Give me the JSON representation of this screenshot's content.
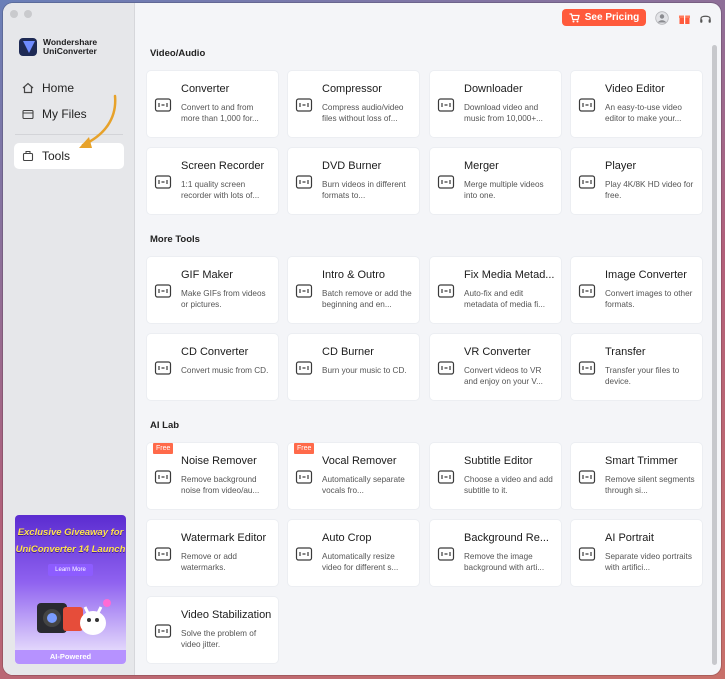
{
  "app": {
    "brand_line1": "Wondershare",
    "brand_line2": "UniConverter"
  },
  "sidebar": {
    "items": [
      {
        "label": "Home",
        "icon": "home-icon"
      },
      {
        "label": "My Files",
        "icon": "folder-icon"
      },
      {
        "label": "Tools",
        "icon": "toolbox-icon",
        "active": true
      }
    ],
    "promo": {
      "title_line1": "Exclusive Giveaway for",
      "title_line2": "UniConverter 14 Launch",
      "button": "Learn More",
      "footer": "AI-Powered"
    }
  },
  "topbar": {
    "pricing_label": "See Pricing",
    "icons": [
      "cart-icon",
      "user-icon",
      "gift-icon",
      "headset-icon"
    ]
  },
  "sections": [
    {
      "title": "Video/Audio",
      "cards": [
        {
          "title": "Converter",
          "desc": "Convert to and from more than 1,000 for...",
          "icon": "converter-icon"
        },
        {
          "title": "Compressor",
          "desc": "Compress audio/video files without loss of...",
          "icon": "compressor-icon"
        },
        {
          "title": "Downloader",
          "desc": "Download video and music from 10,000+...",
          "icon": "downloader-icon"
        },
        {
          "title": "Video Editor",
          "desc": "An easy-to-use video editor to make your...",
          "icon": "video-editor-icon"
        },
        {
          "title": "Screen Recorder",
          "desc": "1:1 quality screen recorder with lots of...",
          "icon": "screen-recorder-icon"
        },
        {
          "title": "DVD Burner",
          "desc": "Burn videos in different formats to...",
          "icon": "dvd-icon"
        },
        {
          "title": "Merger",
          "desc": "Merge multiple videos into one.",
          "icon": "merger-icon"
        },
        {
          "title": "Player",
          "desc": "Play 4K/8K HD video for free.",
          "icon": "player-icon"
        }
      ]
    },
    {
      "title": "More Tools",
      "cards": [
        {
          "title": "GIF Maker",
          "desc": "Make GIFs from videos or pictures.",
          "icon": "gif-icon"
        },
        {
          "title": "Intro & Outro",
          "desc": "Batch remove or add the beginning and en...",
          "icon": "intro-outro-icon"
        },
        {
          "title": "Fix Media Metad...",
          "desc": "Auto-fix and edit metadata of media fi...",
          "icon": "metadata-icon"
        },
        {
          "title": "Image Converter",
          "desc": "Convert images to other formats.",
          "icon": "image-icon"
        },
        {
          "title": "CD Converter",
          "desc": "Convert music from CD.",
          "icon": "cd-converter-icon"
        },
        {
          "title": "CD Burner",
          "desc": "Burn your music to CD.",
          "icon": "cd-burner-icon"
        },
        {
          "title": "VR Converter",
          "desc": "Convert videos to VR and enjoy on your V...",
          "icon": "vr-icon"
        },
        {
          "title": "Transfer",
          "desc": "Transfer your files to device.",
          "icon": "transfer-icon"
        }
      ]
    },
    {
      "title": "AI Lab",
      "cards": [
        {
          "title": "Noise Remover",
          "desc": "Remove background noise from video/au...",
          "icon": "noise-icon",
          "badge": "Free"
        },
        {
          "title": "Vocal Remover",
          "desc": "Automatically separate vocals fro...",
          "icon": "vocal-icon",
          "badge": "Free"
        },
        {
          "title": "Subtitle Editor",
          "desc": "Choose a video and add subtitle to it.",
          "icon": "subtitle-icon"
        },
        {
          "title": "Smart Trimmer",
          "desc": "Remove silent segments through si...",
          "icon": "trimmer-icon"
        },
        {
          "title": "Watermark Editor",
          "desc": "Remove or add watermarks.",
          "icon": "watermark-icon"
        },
        {
          "title": "Auto Crop",
          "desc": "Automatically resize video for different s...",
          "icon": "crop-icon"
        },
        {
          "title": "Background Re...",
          "desc": "Remove the image background with arti...",
          "icon": "background-icon"
        },
        {
          "title": "AI Portrait",
          "desc": "Separate video portraits with artifici...",
          "icon": "portrait-icon"
        },
        {
          "title": "Video Stabilization",
          "desc": "Solve the problem of video jitter.",
          "icon": "stabilization-icon"
        }
      ]
    }
  ],
  "colors": {
    "accent": "#ff5a3c",
    "promo": "#7b4ae6",
    "badge": "#ff6a4a"
  }
}
